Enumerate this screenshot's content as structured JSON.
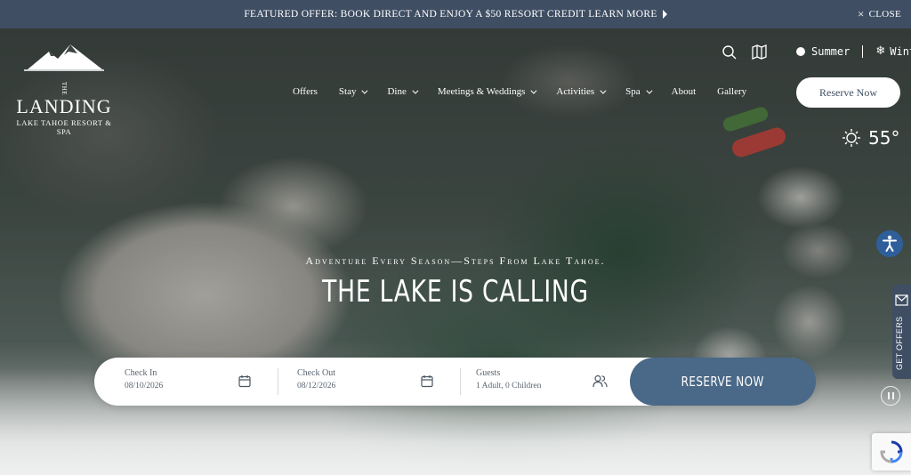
{
  "banner": {
    "offer_text": "FEATURED OFFER: BOOK DIRECT AND ENJOY A $50 RESORT CREDIT LEARN MORE",
    "close_label": "CLOSE"
  },
  "logo": {
    "name": "LANDING",
    "prefix": "THE",
    "subtitle": "LAKE TAHOE RESORT & SPA"
  },
  "seasons": {
    "summer": "Summer",
    "winter": "Winter"
  },
  "nav": {
    "items": [
      {
        "label": "Offers",
        "dropdown": false
      },
      {
        "label": "Stay",
        "dropdown": true
      },
      {
        "label": "Dine",
        "dropdown": true
      },
      {
        "label": "Meetings & Weddings",
        "dropdown": true
      },
      {
        "label": "Activities",
        "dropdown": true
      },
      {
        "label": "Spa",
        "dropdown": true
      },
      {
        "label": "About",
        "dropdown": false
      },
      {
        "label": "Gallery",
        "dropdown": false
      }
    ],
    "reserve_label": "Reserve Now"
  },
  "weather": {
    "temperature": "55°",
    "icon": "sun-icon"
  },
  "hero": {
    "tagline": "Adventure Every Season—Steps From Lake Tahoe.",
    "headline": "THE LAKE IS CALLING"
  },
  "booking": {
    "check_in": {
      "label": "Check In",
      "value": "08/10/2026"
    },
    "check_out": {
      "label": "Check Out",
      "value": "08/12/2026"
    },
    "guests": {
      "label": "Guests",
      "value": "1 Adult, 0 Children"
    },
    "submit_label": "RESERVE NOW"
  },
  "offers_tab": {
    "label": "GET OFFERS"
  },
  "colors": {
    "brand": "#3f4e63",
    "button": "#4a6887",
    "accessibility": "#2f5f9a"
  }
}
